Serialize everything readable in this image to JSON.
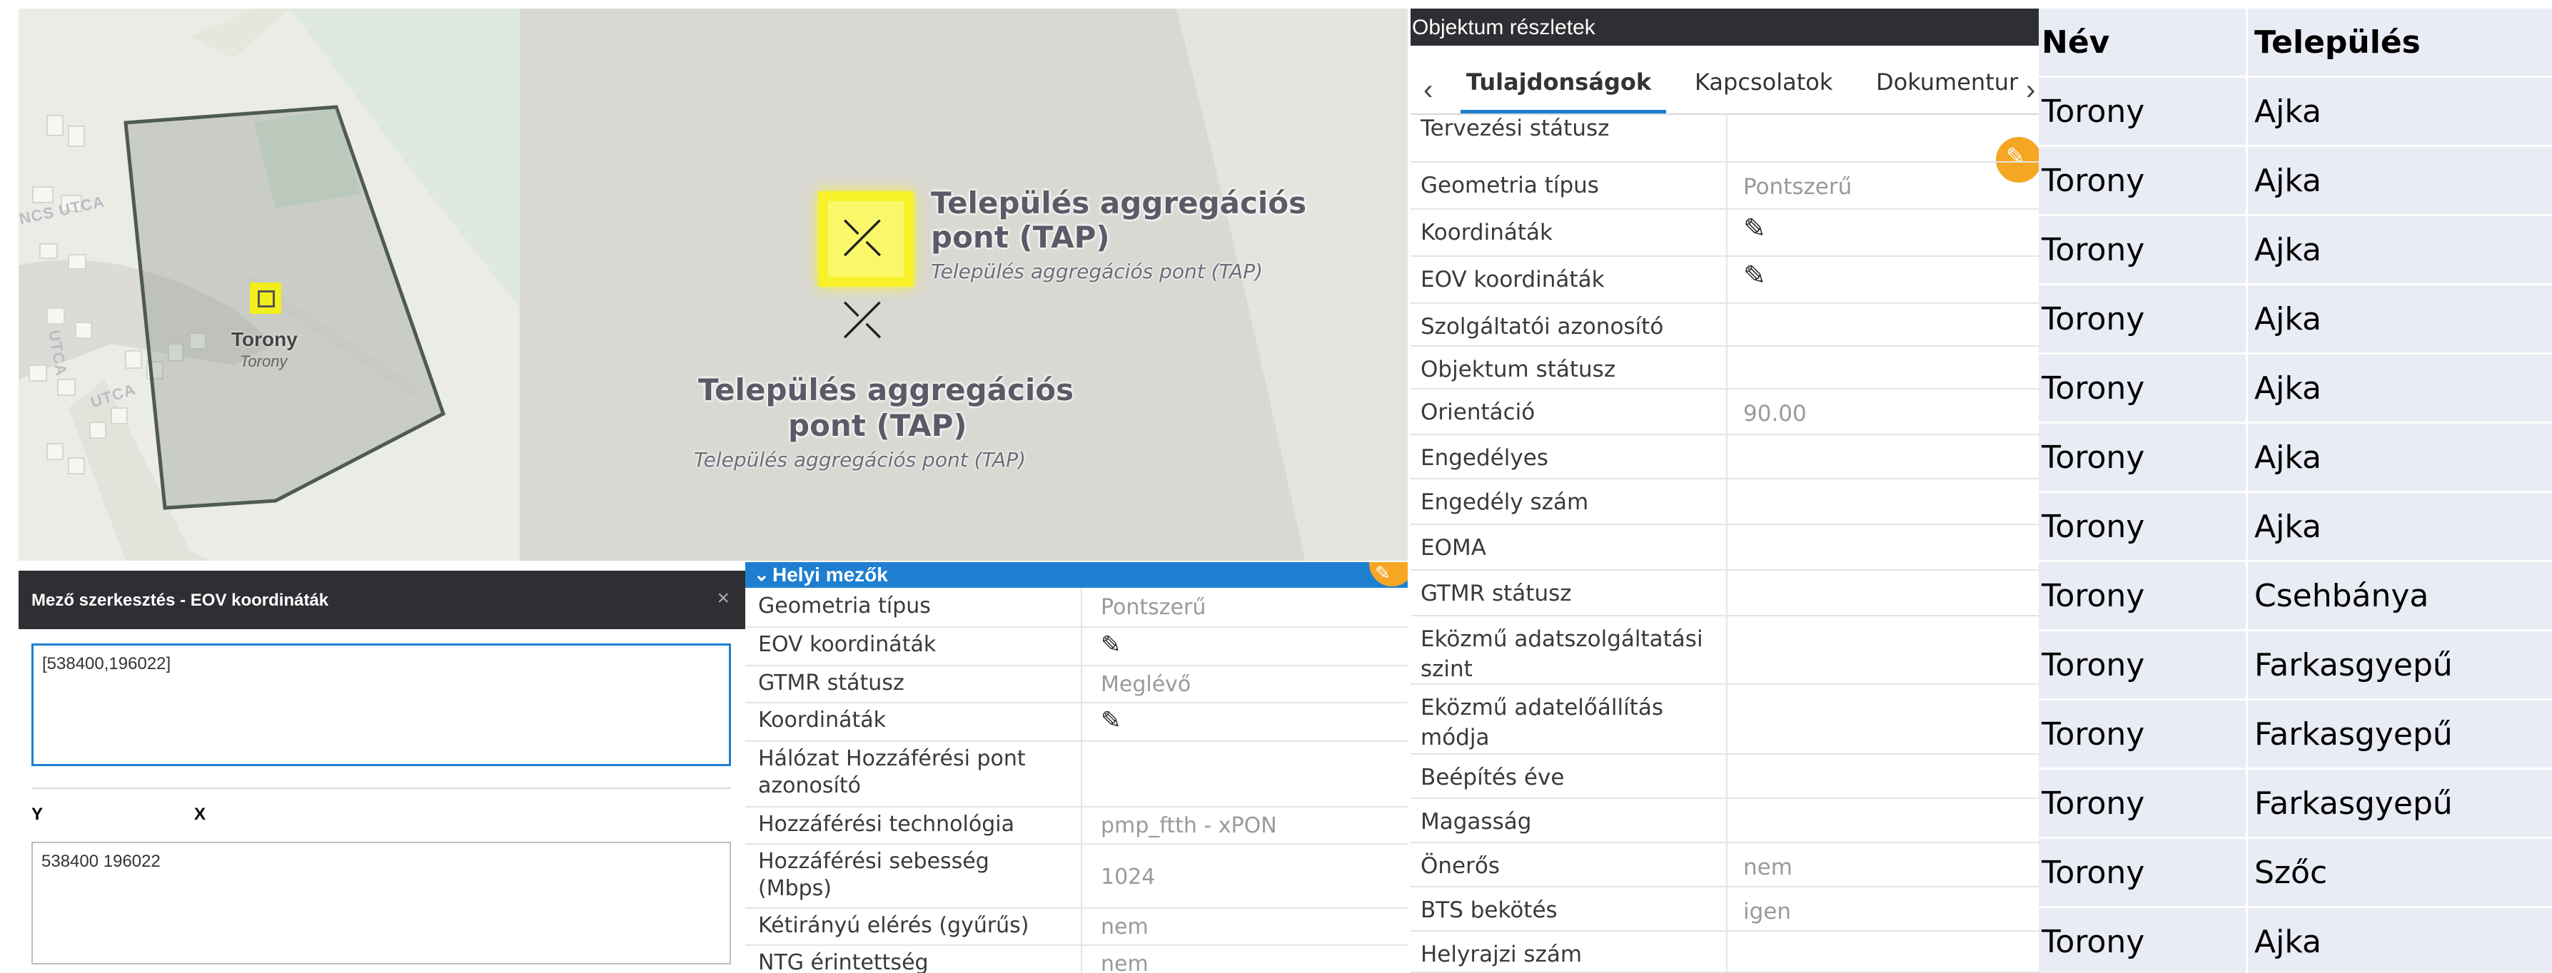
{
  "map1": {
    "streets": [
      "NCS UTCA",
      "UTCA",
      "UTCA"
    ],
    "place_label": "Torony",
    "place_sublabel": "Torony"
  },
  "map2": {
    "tap_title_1": "Település aggregációs",
    "tap_title_2": "pont (TAP)",
    "tap_sub": "Település aggregációs pont (TAP)"
  },
  "dialog": {
    "title": "Mező szerkesztés - EOV koordináták",
    "input_value": "[538400,196022]",
    "y_label": "Y",
    "x_label": "X",
    "output_value": "538400 196022"
  },
  "helyi": {
    "header": "Helyi mezők",
    "rows": [
      {
        "label": "Geometria típus",
        "value": "Pontszerű"
      },
      {
        "label": "EOV koordináták",
        "value": ""
      },
      {
        "label": "GTMR státusz",
        "value": "Meglévő"
      },
      {
        "label": "Koordináták",
        "value": ""
      },
      {
        "label": "Hálózat Hozzáférési pont",
        "label2": "azonosító",
        "value": ""
      },
      {
        "label": "Hozzáférési technológia",
        "value": "pmp_ftth - xPON"
      },
      {
        "label": "Hozzáférési sebesség",
        "label2": "(Mbps)",
        "value": "1024"
      },
      {
        "label": "Kétirányú elérés (gyűrűs)",
        "value": "nem"
      },
      {
        "label": "NTG érintettség",
        "value": "nem"
      }
    ]
  },
  "objektum": {
    "title": "Objektum részletek",
    "tabs": [
      "Tulajdonságok",
      "Kapcsolatok",
      "Dokumentur"
    ],
    "rows": [
      {
        "label": "Tervezési státusz",
        "value": ""
      },
      {
        "label": "Geometria típus",
        "value": "Pontszerű"
      },
      {
        "label": "Koordináták",
        "value": ""
      },
      {
        "label": "EOV koordináták",
        "value": ""
      },
      {
        "label": "Szolgáltatói azonosító",
        "value": ""
      },
      {
        "label": "Objektum státusz",
        "value": ""
      },
      {
        "label": "Orientáció",
        "value": "90.00"
      },
      {
        "label": "Engedélyes",
        "value": ""
      },
      {
        "label": "Engedély szám",
        "value": ""
      },
      {
        "label": "EOMA",
        "value": ""
      },
      {
        "label": "GTMR státusz",
        "value": ""
      },
      {
        "label": "Eközmű adatszolgáltatási",
        "label2": "szint",
        "value": ""
      },
      {
        "label": "Eközmű adatelőállítás",
        "label2": "módja",
        "value": ""
      },
      {
        "label": "Beépítés éve",
        "value": ""
      },
      {
        "label": "Magasság",
        "value": ""
      },
      {
        "label": "Önerős",
        "value": "nem"
      },
      {
        "label": "BTS bekötés",
        "value": "igen"
      },
      {
        "label": "Helyrajzi szám",
        "value": ""
      }
    ]
  },
  "table": {
    "headers": [
      "Név",
      "Település"
    ],
    "rows": [
      [
        "Torony",
        "Ajka"
      ],
      [
        "Torony",
        "Ajka"
      ],
      [
        "Torony",
        "Ajka"
      ],
      [
        "Torony",
        "Ajka"
      ],
      [
        "Torony",
        "Ajka"
      ],
      [
        "Torony",
        "Ajka"
      ],
      [
        "Torony",
        "Ajka"
      ],
      [
        "Torony",
        "Csehbánya"
      ],
      [
        "Torony",
        "Farkasgyepű"
      ],
      [
        "Torony",
        "Farkasgyepű"
      ],
      [
        "Torony",
        "Farkasgyepű"
      ],
      [
        "Torony",
        "Szőc"
      ],
      [
        "Torony",
        "Ajka"
      ]
    ]
  },
  "colors": {
    "dark_header": "#2e2f33",
    "blue_header": "#1e7fd1",
    "edit_badge": "#f5a623",
    "tap_highlight": "#f2ee1a"
  }
}
